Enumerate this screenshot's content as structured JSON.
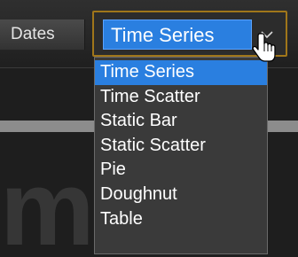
{
  "toolbar": {
    "dates_label": "Dates"
  },
  "chart_type_select": {
    "value": "Time Series",
    "options": [
      "Time Series",
      "Time Scatter",
      "Static Bar",
      "Static Scatter",
      "Pie",
      "Doughnut",
      "Table"
    ],
    "selected_index": 0
  },
  "icons": {
    "dropdown_arrow": "chevron-down-icon",
    "pointer": "hand-pointer-icon"
  },
  "colors": {
    "selection": "#2a7fe0",
    "focus_border": "#a0761a",
    "background": "#1e1e1e"
  }
}
